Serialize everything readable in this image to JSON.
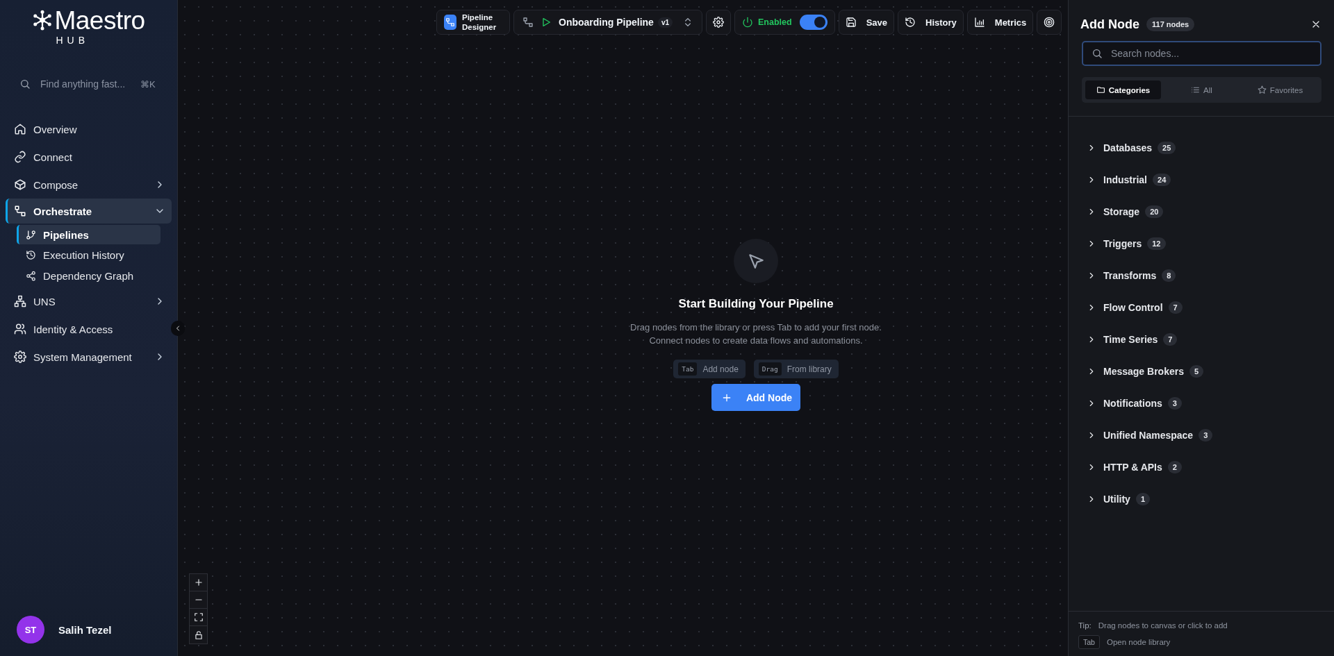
{
  "sidebar": {
    "logo": {
      "name": "Maestro",
      "sub": "HUB"
    },
    "search": {
      "placeholder": "Find anything fast...",
      "shortcut": "⌘K"
    },
    "nav": [
      {
        "label": "Overview",
        "kind": "link",
        "selected": false
      },
      {
        "label": "Connect",
        "kind": "link",
        "selected": false
      },
      {
        "label": "Compose",
        "kind": "group",
        "selected": false,
        "expanded": false
      },
      {
        "label": "Orchestrate",
        "kind": "group",
        "selected": true,
        "expanded": true,
        "children": [
          {
            "label": "Pipelines",
            "selected": true
          },
          {
            "label": "Execution History",
            "selected": false
          },
          {
            "label": "Dependency Graph",
            "selected": false
          }
        ]
      },
      {
        "label": "UNS",
        "kind": "group",
        "selected": false,
        "expanded": false
      },
      {
        "label": "Identity & Access",
        "kind": "link",
        "selected": false
      },
      {
        "label": "System Management",
        "kind": "group",
        "selected": false,
        "expanded": false
      }
    ],
    "user": {
      "initials": "ST",
      "name": "Salih Tezel",
      "color": "#9333ea"
    }
  },
  "toolbar": {
    "designer": "Pipeline Designer",
    "pipeline": {
      "name": "Onboarding Pipeline",
      "version": "v1"
    },
    "enabled": {
      "label": "Enabled",
      "on": true
    },
    "buttons": [
      "Save",
      "History",
      "Metrics"
    ]
  },
  "canvas": {
    "empty_state": {
      "title": "Start Building Your Pipeline",
      "lines": [
        "Drag nodes from the library or press Tab to add your first node.",
        "Connect nodes to create data flows and automations."
      ],
      "hints": [
        {
          "key": "Tab",
          "label": "Add node"
        },
        {
          "key": "Drag",
          "label": "From library"
        }
      ],
      "button": "Add Node"
    }
  },
  "add_node_panel": {
    "title": "Add Node",
    "count": "117 nodes",
    "search": {
      "placeholder": "Search nodes..."
    },
    "tabs": [
      {
        "label": "Categories",
        "selected": true
      },
      {
        "label": "All",
        "selected": false
      },
      {
        "label": "Favorites",
        "selected": false
      }
    ],
    "categories": [
      {
        "name": "Databases",
        "count": "25",
        "expanded": false
      },
      {
        "name": "Industrial",
        "count": "24",
        "expanded": false
      },
      {
        "name": "Storage",
        "count": "20",
        "expanded": false
      },
      {
        "name": "Triggers",
        "count": "12",
        "expanded": false
      },
      {
        "name": "Transforms",
        "count": "8",
        "expanded": false
      },
      {
        "name": "Flow Control",
        "count": "7",
        "expanded": false
      },
      {
        "name": "Time Series",
        "count": "7",
        "expanded": false
      },
      {
        "name": "Message Brokers",
        "count": "5",
        "expanded": false
      },
      {
        "name": "Notifications",
        "count": "3",
        "expanded": false
      },
      {
        "name": "Unified Namespace",
        "count": "3",
        "expanded": false
      },
      {
        "name": "HTTP & APIs",
        "count": "2",
        "expanded": false
      },
      {
        "name": "Utility",
        "count": "1",
        "expanded": false
      }
    ],
    "tip": {
      "label": "Tip:",
      "text": "Drag nodes to canvas or click to add"
    },
    "shortcut": {
      "key": "Tab",
      "label": "Open node library"
    }
  }
}
